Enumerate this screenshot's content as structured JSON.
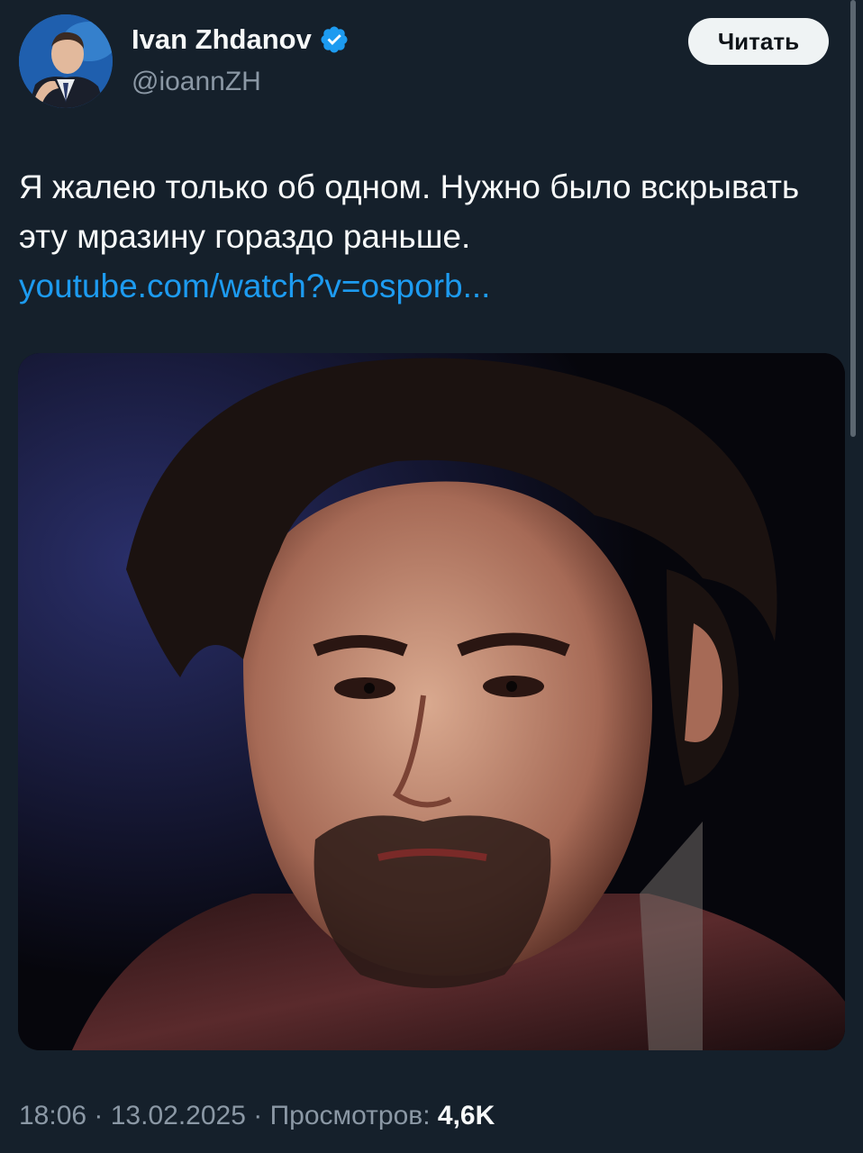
{
  "author": {
    "name": "Ivan Zhdanov",
    "handle": "@ioannZH",
    "verified": true,
    "avatar_icon": "profile-photo"
  },
  "follow_button": {
    "label": "Читать"
  },
  "tweet": {
    "text_line1": "Я жалею только об одном. Нужно было вскрывать эту мразину гораздо раньше.",
    "link_text": "youtube.com/watch?v=osporb..."
  },
  "media": {
    "description_icon": "photo-portrait"
  },
  "meta": {
    "time": "18:06",
    "separator1": " · ",
    "date": "13.02.2025",
    "separator2": " · ",
    "views_label": "Просмотров: ",
    "views_count": "4,6K"
  },
  "colors": {
    "background": "#15202b",
    "link": "#1d9bf0",
    "verified_badge": "#1d9bf0",
    "secondary_text": "#8b98a5",
    "follow_button_bg": "#eff3f4"
  }
}
